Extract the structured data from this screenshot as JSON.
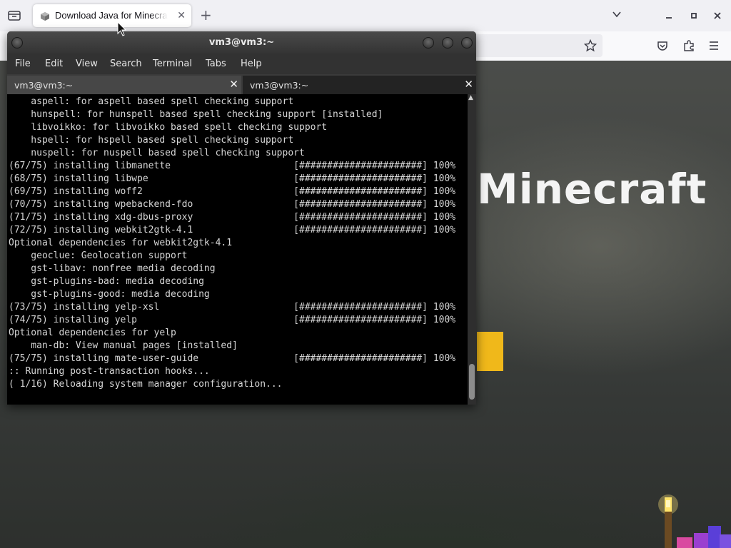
{
  "browser": {
    "tab_title": "Download Java for Minecraft",
    "new_tab_symbol": "+",
    "close_symbol": "✕"
  },
  "webpage": {
    "hero_title": "Minecraft"
  },
  "terminal": {
    "title": "vm3@vm3:~",
    "menu": [
      "File",
      "Edit",
      "View",
      "Search",
      "Terminal",
      "Tabs",
      "Help"
    ],
    "tabs": [
      {
        "label": "vm3@vm3:~",
        "active": false
      },
      {
        "label": "vm3@vm3:~",
        "active": true
      }
    ],
    "lines": [
      "    aspell: for aspell based spell checking support",
      "    hunspell: for hunspell based spell checking support [installed]",
      "    libvoikko: for libvoikko based spell checking support",
      "    hspell: for hspell based spell checking support",
      "    nuspell: for nuspell based spell checking support",
      "(67/75) installing libmanette                      [######################] 100%",
      "(68/75) installing libwpe                          [######################] 100%",
      "(69/75) installing woff2                           [######################] 100%",
      "(70/75) installing wpebackend-fdo                  [######################] 100%",
      "(71/75) installing xdg-dbus-proxy                  [######################] 100%",
      "(72/75) installing webkit2gtk-4.1                  [######################] 100%",
      "Optional dependencies for webkit2gtk-4.1",
      "    geoclue: Geolocation support",
      "    gst-libav: nonfree media decoding",
      "    gst-plugins-bad: media decoding",
      "    gst-plugins-good: media decoding",
      "(73/75) installing yelp-xsl                        [######################] 100%",
      "(74/75) installing yelp                            [######################] 100%",
      "Optional dependencies for yelp",
      "    man-db: View manual pages [installed]",
      "(75/75) installing mate-user-guide                 [######################] 100%",
      ":: Running post-transaction hooks...",
      "( 1/16) Reloading system manager configuration..."
    ]
  },
  "colors": {
    "accent_yellow": "#f0b81a",
    "terminal_bg": "#000000",
    "terminal_fg": "#d6d6d6"
  },
  "icons": [
    "tab-list-icon",
    "cube-favicon-icon",
    "close-icon",
    "plus-icon",
    "chevron-down-icon",
    "minimize-icon",
    "maximize-icon",
    "window-close-icon",
    "bookmark-star-icon",
    "pocket-icon",
    "extensions-icon",
    "hamburger-menu-icon",
    "mouse-cursor-icon"
  ]
}
